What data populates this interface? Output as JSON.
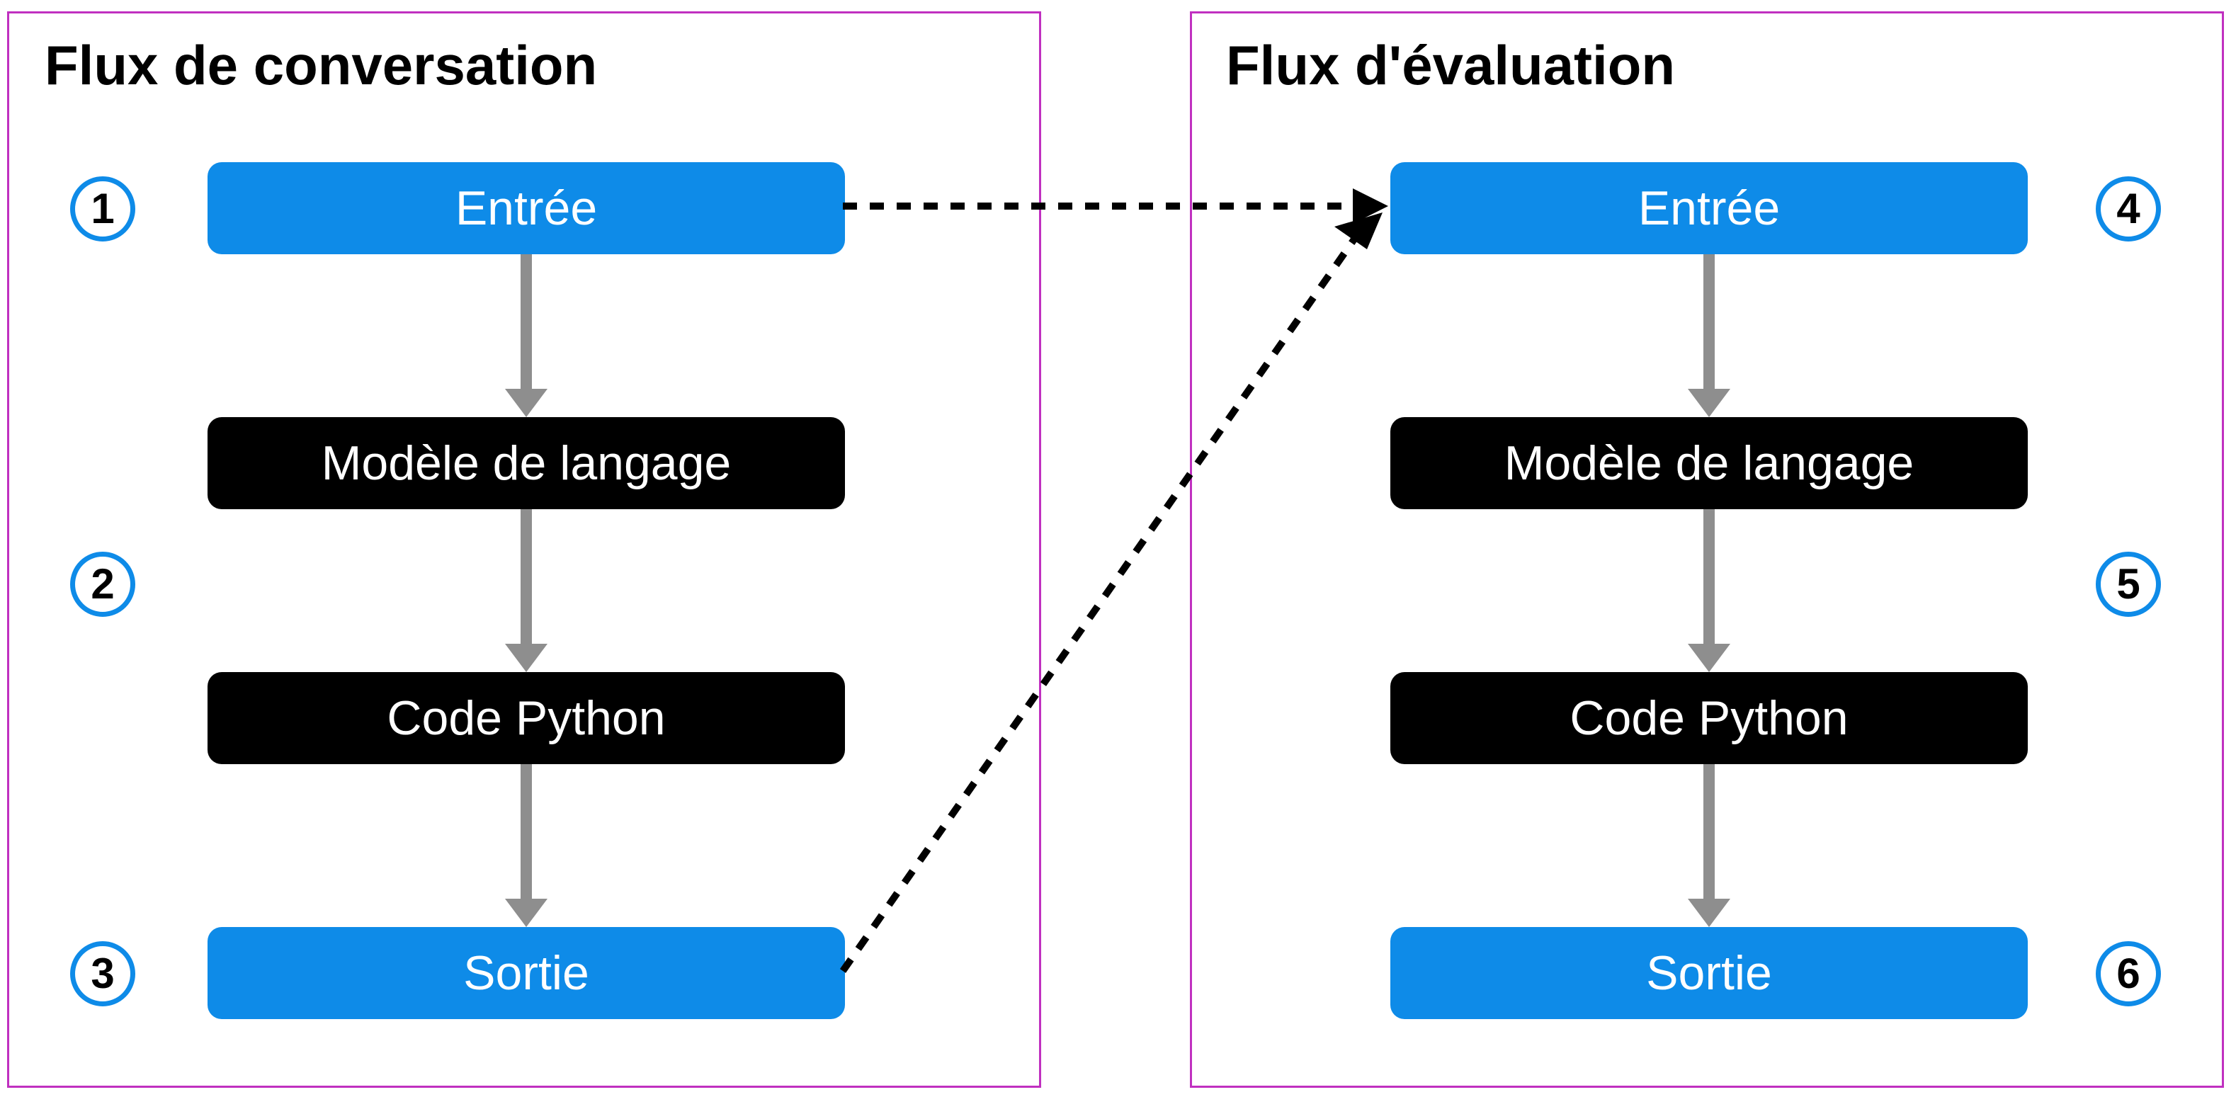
{
  "left": {
    "title": "Flux de conversation",
    "nodes": {
      "input": "Entrée",
      "language_model": "Modèle de langage",
      "python_code": "Code Python",
      "output": "Sortie"
    },
    "badges": {
      "b1": "1",
      "b2": "2",
      "b3": "3"
    }
  },
  "right": {
    "title": "Flux d'évaluation",
    "nodes": {
      "input": "Entrée",
      "language_model": "Modèle de langage",
      "python_code": "Code Python",
      "output": "Sortie"
    },
    "badges": {
      "b1": "4",
      "b2": "5",
      "b3": "6"
    }
  },
  "colors": {
    "blue": "#0e8be8",
    "black": "#000000",
    "border": "#c030c0",
    "arrow_gray": "#8e8e8e"
  }
}
